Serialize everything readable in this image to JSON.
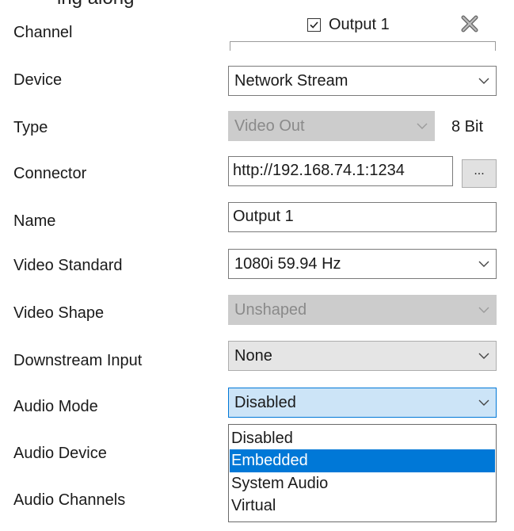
{
  "clipped_header_text": "ing along",
  "channel": {
    "label": "Channel",
    "checkbox_checked": true,
    "output_label": "Output 1"
  },
  "device": {
    "label": "Device",
    "value": "Network Stream"
  },
  "type": {
    "label": "Type",
    "value": "Video Out",
    "bit_depth": "8 Bit"
  },
  "connector": {
    "label": "Connector",
    "value": "http://192.168.74.1:1234",
    "browse_label": "..."
  },
  "name": {
    "label": "Name",
    "value": "Output 1"
  },
  "video_standard": {
    "label": "Video Standard",
    "value": "1080i 59.94 Hz"
  },
  "video_shape": {
    "label": "Video Shape",
    "value": "Unshaped"
  },
  "downstream_input": {
    "label": "Downstream Input",
    "value": "None"
  },
  "audio_mode": {
    "label": "Audio Mode",
    "value": "Disabled",
    "options": [
      "Disabled",
      "Embedded",
      "System Audio",
      "Virtual"
    ],
    "highlighted_index": 1
  },
  "audio_device": {
    "label": "Audio Device"
  },
  "audio_channels": {
    "label": "Audio Channels"
  },
  "colors": {
    "accent": "#0078d7",
    "focused_bg": "#cce4f7",
    "disabled_bg": "#cccccc"
  }
}
